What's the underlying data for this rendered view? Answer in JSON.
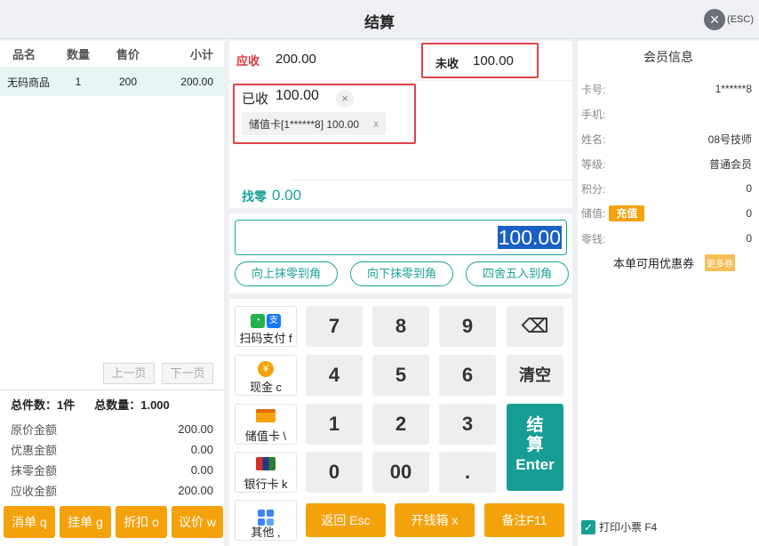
{
  "window": {
    "title": "结算",
    "close_label": "(ESC)"
  },
  "cart": {
    "headers": [
      "品名",
      "数量",
      "售价",
      "小计"
    ],
    "rows": [
      {
        "name": "无码商品",
        "qty": "1",
        "price": "200",
        "subtotal": "200.00"
      }
    ],
    "prev_page": "上一页",
    "next_page": "下一页"
  },
  "summary": {
    "total_items": "总件数：1件",
    "total_qty": "总数量：1.000",
    "lines": [
      {
        "label": "原价金额",
        "value": "200.00"
      },
      {
        "label": "优惠金额",
        "value": "0.00"
      },
      {
        "label": "抹零金额",
        "value": "0.00"
      },
      {
        "label": "应收金额",
        "value": "200.00"
      }
    ]
  },
  "left_buttons": [
    "消单 q",
    "挂单 g",
    "折扣 o",
    "议价 w"
  ],
  "payment": {
    "due_label": "应收",
    "due_value": "200.00",
    "unpaid_label": "未收",
    "unpaid_value": "100.00",
    "received_label": "已收",
    "received_value": "100.00",
    "received_clear": "×",
    "card_tag": "储值卡[1******8] 100.00",
    "card_tag_remove": "x",
    "change_label": "找零",
    "change_value": "0.00"
  },
  "input": {
    "amount": "100.00",
    "round_buttons": [
      "向上抹零到角",
      "向下抹零到角",
      "四舍五入到角"
    ]
  },
  "pay_methods": [
    {
      "label": "扫码支付 f",
      "icon": "qr-pay-icon"
    },
    {
      "label": "现金 c",
      "icon": "cash-icon"
    },
    {
      "label": "储值卡 \\",
      "icon": "stored-card-icon"
    },
    {
      "label": "银行卡 k",
      "icon": "bank-card-icon"
    },
    {
      "label": "其他 ,",
      "icon": "other-icon"
    }
  ],
  "keys": [
    "7",
    "8",
    "9",
    "4",
    "5",
    "6",
    "1",
    "2",
    "3",
    "0",
    "00",
    "."
  ],
  "special_keys": {
    "backspace": "⌫",
    "clear": "清空",
    "settle_1": "结",
    "settle_2": "算",
    "settle_3": "Enter"
  },
  "bottom_buttons": [
    "返回 Esc",
    "开钱箱 x",
    "备注F11"
  ],
  "member": {
    "title": "会员信息",
    "rows": [
      {
        "label": "卡号:",
        "value": "1******8"
      },
      {
        "label": "手机:",
        "value": ""
      },
      {
        "label": "姓名:",
        "value": "08号技师"
      },
      {
        "label": "等级:",
        "value": "普通会员"
      },
      {
        "label": "积分:",
        "value": "0"
      },
      {
        "label": "储值:",
        "value": "0"
      },
      {
        "label": "零钱:",
        "value": "0"
      }
    ],
    "charge_label": "充值",
    "coupon_label": "本单可用优惠券",
    "coupon_btn": "更多券",
    "print_label": "打印小票 F4"
  },
  "colors": {
    "accent": "#1aa39a",
    "orange": "#f4a20c",
    "red": "#e0424a"
  }
}
